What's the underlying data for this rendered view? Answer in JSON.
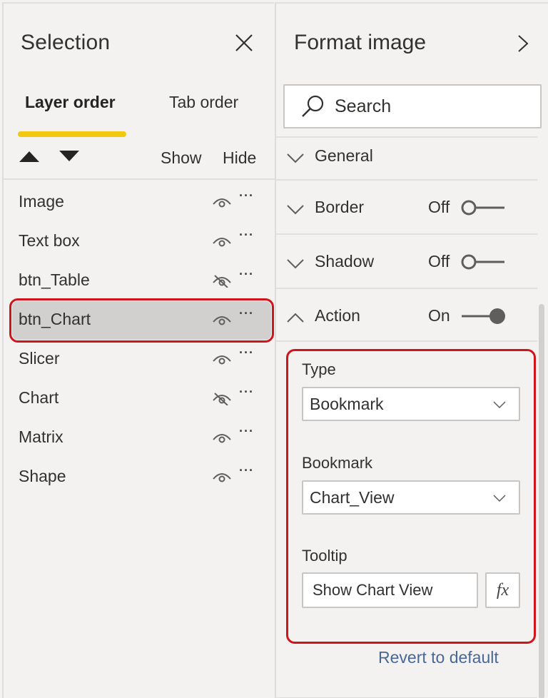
{
  "selection_pane": {
    "title": "Selection",
    "close_icon": "close-icon",
    "tabs": [
      {
        "label": "Layer order",
        "active": true
      },
      {
        "label": "Tab order",
        "active": false
      }
    ],
    "move_up_icon": "triangle-up-icon",
    "move_down_icon": "triangle-down-icon",
    "show_label": "Show",
    "hide_label": "Hide",
    "layers": [
      {
        "name": "Image",
        "visible": true,
        "selected": false
      },
      {
        "name": "Text box",
        "visible": true,
        "selected": false
      },
      {
        "name": "btn_Table",
        "visible": false,
        "selected": false
      },
      {
        "name": "btn_Chart",
        "visible": true,
        "selected": true
      },
      {
        "name": "Slicer",
        "visible": true,
        "selected": false
      },
      {
        "name": "Chart",
        "visible": false,
        "selected": false
      },
      {
        "name": "Matrix",
        "visible": true,
        "selected": false
      },
      {
        "name": "Shape",
        "visible": true,
        "selected": false
      }
    ],
    "more_options": "···"
  },
  "format_pane": {
    "title": "Format image",
    "expand_icon": "chevron-right-icon",
    "search": {
      "placeholder": "Search",
      "value": ""
    },
    "sections": [
      {
        "label": "General",
        "expanded": false
      },
      {
        "label": "Border",
        "expanded": false,
        "toggle_label": "Off",
        "toggle_on": false
      },
      {
        "label": "Shadow",
        "expanded": false,
        "toggle_label": "Off",
        "toggle_on": false
      },
      {
        "label": "Action",
        "expanded": true,
        "toggle_label": "On",
        "toggle_on": true
      }
    ],
    "action": {
      "type_label": "Type",
      "type_value": "Bookmark",
      "bookmark_label": "Bookmark",
      "bookmark_value": "Chart_View",
      "tooltip_label": "Tooltip",
      "tooltip_value": "Show Chart View",
      "fx_label": "fx"
    },
    "revert_label": "Revert to default"
  },
  "colors": {
    "highlight_outline": "#d0141c",
    "tab_underline": "#f2c811",
    "link": "#4a6896",
    "background": "#f3f2f1"
  }
}
